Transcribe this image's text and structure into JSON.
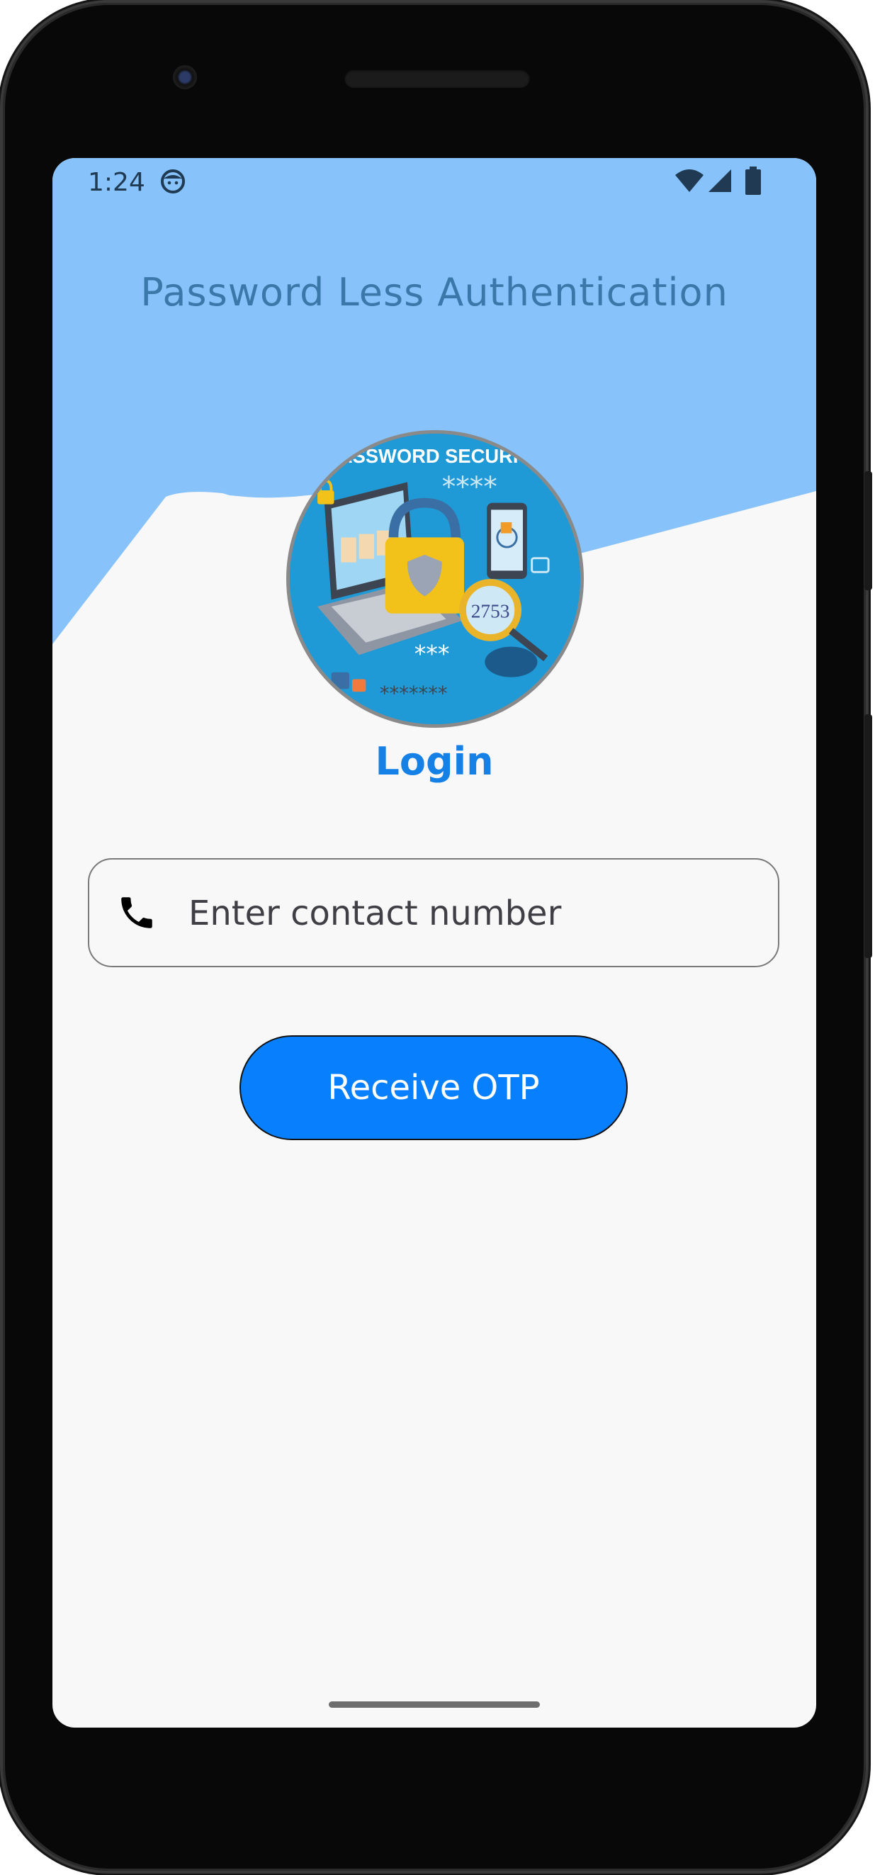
{
  "status_bar": {
    "time": "1:24"
  },
  "header": {
    "title": "Password Less Authentication"
  },
  "illustration": {
    "caption_text": "PASSWORD SECURITY",
    "code_text": "2753"
  },
  "login": {
    "heading": "Login",
    "contact_field": {
      "placeholder": "Enter contact number",
      "value": ""
    },
    "submit_label": "Receive OTP"
  },
  "colors": {
    "header_background": "#87C2FA",
    "title_text": "#3B78AA",
    "heading_text": "#1580E6",
    "button_background": "#0880FD",
    "screen_background": "#F8F8F8"
  }
}
